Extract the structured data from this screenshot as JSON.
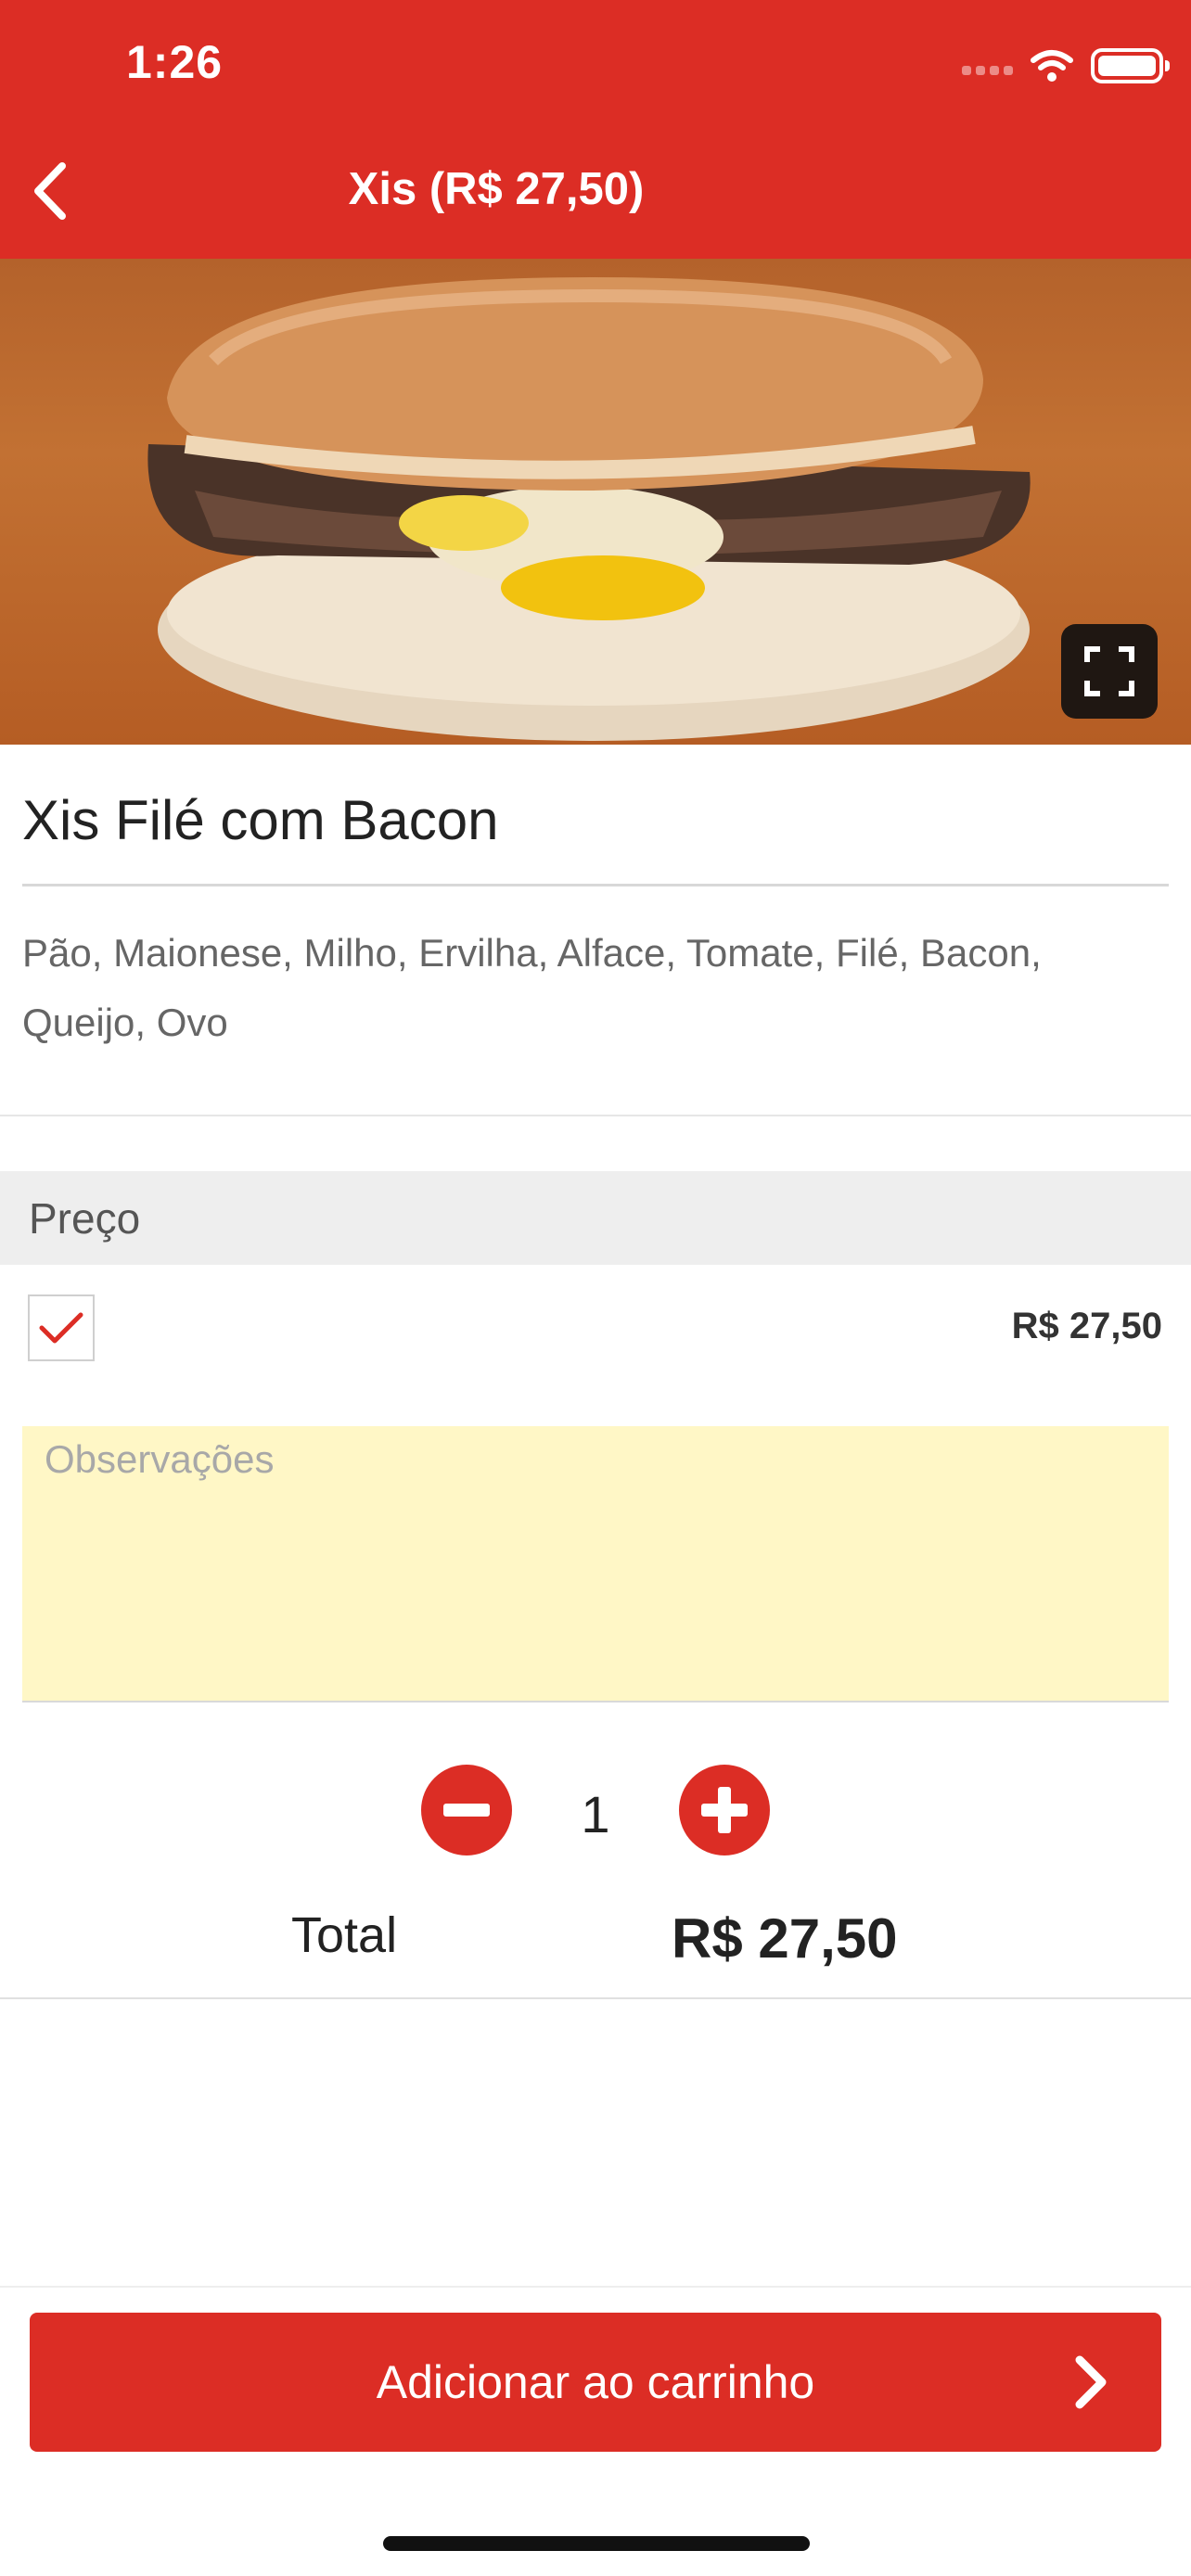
{
  "status_bar": {
    "time": "1:26"
  },
  "nav": {
    "title": "Xis (R$ 27,50)",
    "back_icon": "chevron-left-icon"
  },
  "hero": {
    "expand_icon": "fullscreen-icon"
  },
  "product": {
    "name": "Xis Filé com Bacon",
    "ingredients": "Pão, Maionese, Milho, Ervilha, Alface, Tomate, Filé, Bacon, Queijo, Ovo"
  },
  "price_section": {
    "header": "Preço",
    "option_checked": true,
    "option_price": "R$ 27,50"
  },
  "notes": {
    "placeholder": "Observações",
    "value": ""
  },
  "quantity": {
    "value": "1"
  },
  "total": {
    "label": "Total",
    "value": "R$ 27,50"
  },
  "cart_button": {
    "label": "Adicionar ao carrinho"
  },
  "colors": {
    "brand": "#dc2d25",
    "notes_bg": "#fff7c6",
    "section_bg": "#eeeeee"
  }
}
